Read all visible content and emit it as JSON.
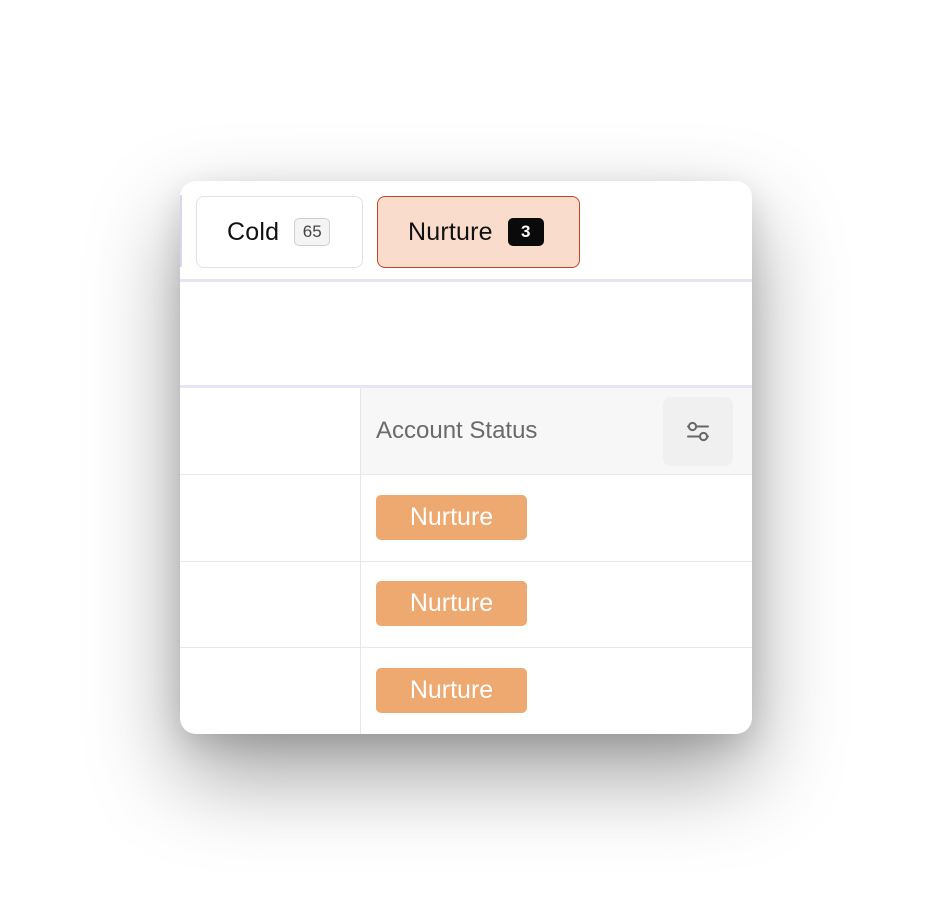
{
  "tabs": [
    {
      "label": "Cold",
      "count": "65"
    },
    {
      "label": "Nurture",
      "count": "3",
      "active": true
    }
  ],
  "table": {
    "header": {
      "label": "Account Status",
      "filter_icon": "sliders-icon"
    },
    "rows": [
      {
        "status": "Nurture"
      },
      {
        "status": "Nurture"
      },
      {
        "status": "Nurture"
      }
    ]
  },
  "colors": {
    "active_tab_bg": "#fadccd",
    "active_tab_border": "#c2452a",
    "status_pill_bg": "#eda96f",
    "divider": "#e6e4f5"
  }
}
